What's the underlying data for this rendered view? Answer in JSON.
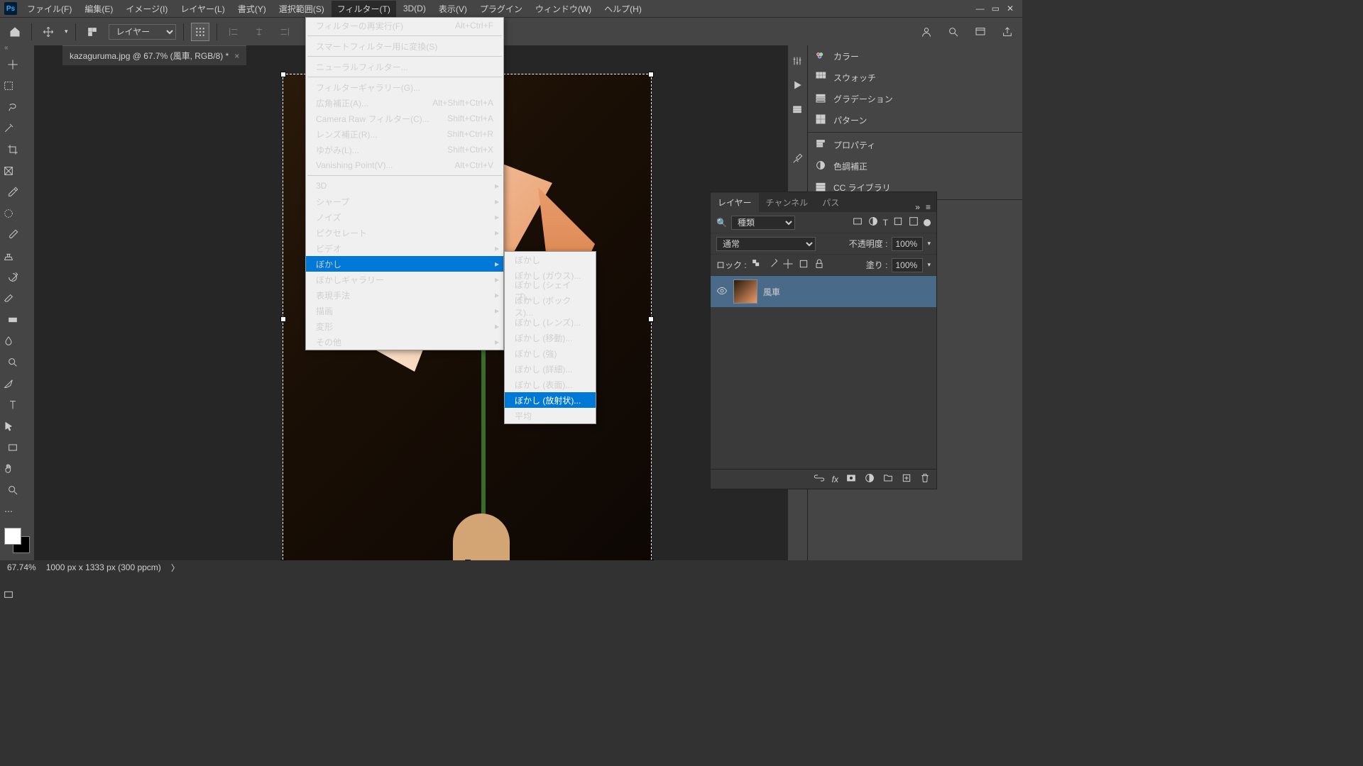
{
  "menubar": {
    "items": [
      "ファイル(F)",
      "編集(E)",
      "イメージ(I)",
      "レイヤー(L)",
      "書式(Y)",
      "選択範囲(S)",
      "フィルター(T)",
      "3D(D)",
      "表示(V)",
      "プラグイン",
      "ウィンドウ(W)",
      "ヘルプ(H)"
    ]
  },
  "optbar": {
    "layer_select": "レイヤー"
  },
  "tab": {
    "title": "kazaguruma.jpg @ 67.7% (風車, RGB/8) *"
  },
  "filter_menu": [
    {
      "label": "フィルターの再実行(F)",
      "shortcut": "Alt+Ctrl+F",
      "disabled": true
    },
    {
      "sep": true
    },
    {
      "label": "スマートフィルター用に変換(S)"
    },
    {
      "sep": true
    },
    {
      "label": "ニューラルフィルター..."
    },
    {
      "sep": true
    },
    {
      "label": "フィルターギャラリー(G)..."
    },
    {
      "label": "広角補正(A)...",
      "shortcut": "Alt+Shift+Ctrl+A"
    },
    {
      "label": "Camera Raw フィルター(C)...",
      "shortcut": "Shift+Ctrl+A"
    },
    {
      "label": "レンズ補正(R)...",
      "shortcut": "Shift+Ctrl+R"
    },
    {
      "label": "ゆがみ(L)...",
      "shortcut": "Shift+Ctrl+X"
    },
    {
      "label": "Vanishing Point(V)...",
      "shortcut": "Alt+Ctrl+V"
    },
    {
      "sep": true
    },
    {
      "label": "3D",
      "arrow": true
    },
    {
      "label": "シャープ",
      "arrow": true
    },
    {
      "label": "ノイズ",
      "arrow": true
    },
    {
      "label": "ピクセレート",
      "arrow": true
    },
    {
      "label": "ビデオ",
      "arrow": true
    },
    {
      "label": "ぼかし",
      "arrow": true,
      "hl": true
    },
    {
      "label": "ぼかしギャラリー",
      "arrow": true
    },
    {
      "label": "表現手法",
      "arrow": true
    },
    {
      "label": "描画",
      "arrow": true
    },
    {
      "label": "変形",
      "arrow": true
    },
    {
      "label": "その他",
      "arrow": true
    }
  ],
  "blur_submenu": [
    {
      "label": "ぼかし"
    },
    {
      "label": "ぼかし (ガウス)..."
    },
    {
      "label": "ぼかし (シェイプ)..."
    },
    {
      "label": "ぼかし (ボックス)..."
    },
    {
      "label": "ぼかし (レンズ)..."
    },
    {
      "label": "ぼかし (移動)..."
    },
    {
      "label": "ぼかし (強)"
    },
    {
      "label": "ぼかし (詳細)..."
    },
    {
      "label": "ぼかし (表面)..."
    },
    {
      "label": "ぼかし (放射状)...",
      "hl": true
    },
    {
      "label": "平均"
    }
  ],
  "right_panels": [
    "カラー",
    "スウォッチ",
    "グラデーション",
    "パターン",
    "",
    "プロパティ",
    "色調補正",
    "CC ライブラリ",
    "",
    "レイヤー",
    "チャンネル",
    "パス"
  ],
  "layers": {
    "tabs": [
      "レイヤー",
      "チャンネル",
      "パス"
    ],
    "kind": "種類",
    "blend": "通常",
    "opacity_label": "不透明度 :",
    "opacity": "100%",
    "lock_label": "ロック :",
    "fill_label": "塗り :",
    "fill": "100%",
    "layer_name": "風車"
  },
  "status": {
    "zoom": "67.74%",
    "dims": "1000 px x 1333 px (300 ppcm)"
  }
}
